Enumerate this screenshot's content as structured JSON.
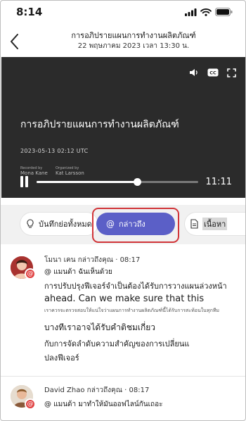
{
  "status_bar": {
    "time": "8:14"
  },
  "nav": {
    "title": "การอภิปรายแผนการทำงานผลิตภัณฑ์",
    "subtitle": "22 พฤษภาคม 2023 เวลา 13:30 น."
  },
  "video": {
    "title": "การอภิปรายแผนการทำงานผลิตภัณฑ์",
    "date": "2023-05-13 02:12 UTC",
    "recorded_by_label": "Recorded by",
    "recorded_by": "Mona Kane",
    "organized_by_label": "Organized by",
    "organized_by": "Kat Larsson",
    "duration": "11:11",
    "progress": 0.62
  },
  "tabs": [
    {
      "label": "บันทึกย่อทั้งหมด",
      "icon": "lightbulb-icon"
    },
    {
      "label": "กล่าวถึง",
      "icon": "at-sign-icon",
      "active": true
    },
    {
      "label": "เนื้อหา",
      "icon": "document-icon"
    }
  ],
  "feed": {
    "items": [
      {
        "header": "โมนา เคน กล่าวถึงคุณ · 08:17",
        "mention": "@ แมนด้า ฉันเห็นด้วย",
        "line1": "การปรับปรุงฟีเจอร์จำเป็นต้องได้รับการวางแผนล่วงหน้า",
        "line2": "ahead. Can we make sure that this",
        "line3": "เราควรจะตรวจสอบให้แน่ใจว่าแผนการทำงานผลิตภัณฑ์นี้ได้รับการสะท้อนในทุกทีม",
        "line4": "บางทีเราอาจได้รับคำติชมเกี่ยว",
        "line5": "กับการจัดลำดับความสำคัญของการเปลี่ยนแ",
        "line6": "ปลงฟีเจอร์"
      },
      {
        "header": "David Zhao กล่าวถึงคุณ · 08:17",
        "mention": "@ แมนด้า มาทำให้มันออฟไลน์กันเถอะ"
      }
    ]
  },
  "colors": {
    "accent": "#5b5fc7",
    "highlight": "#d13438",
    "badge": "#e03f3f"
  }
}
